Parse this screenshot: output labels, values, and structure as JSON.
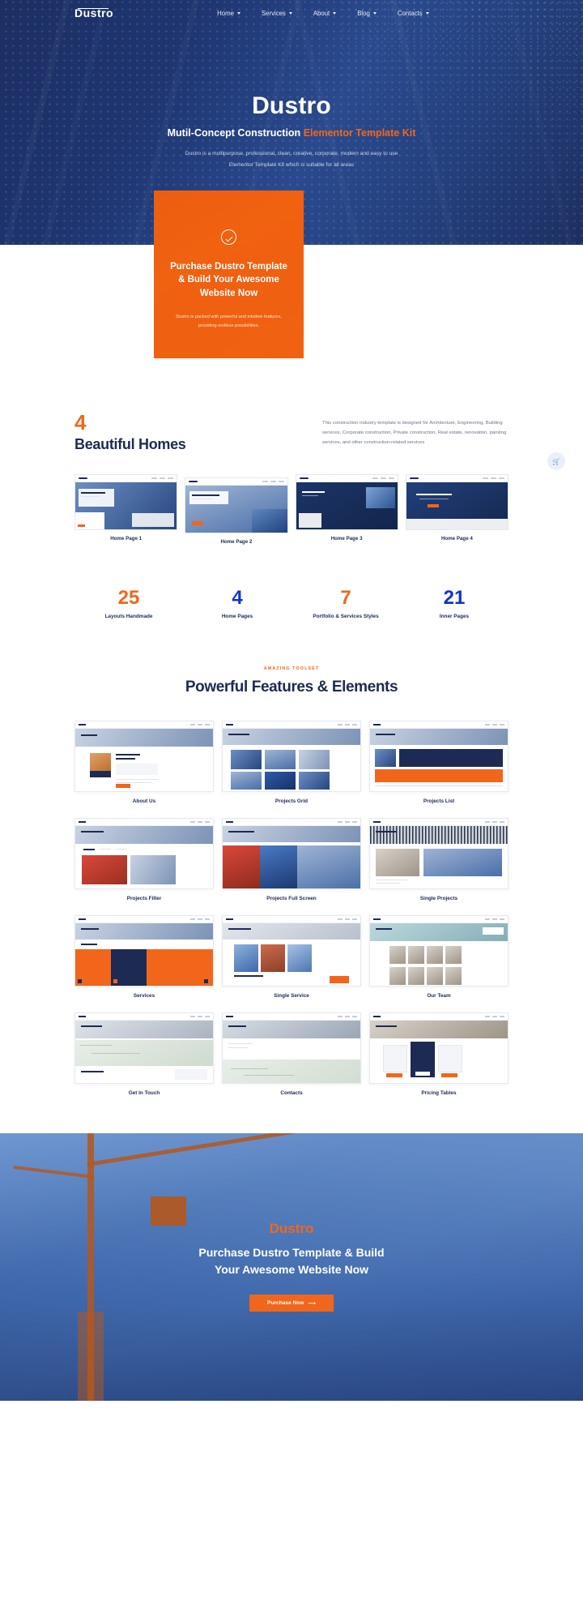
{
  "header": {
    "logo": "Dustro",
    "nav": [
      {
        "label": "Home"
      },
      {
        "label": "Services"
      },
      {
        "label": "About"
      },
      {
        "label": "Blog"
      },
      {
        "label": "Contacts"
      }
    ]
  },
  "hero": {
    "title": "Dustro",
    "subtitle_main": "Mutil-Concept Construction",
    "subtitle_accent": "Elementor Template Kit",
    "desc_line1": "Dustro is a multipurpose, professional, clean, creative, corporate, modern and easy to use",
    "desc_line2": "Elementor Template Kit which is suitable for all areas"
  },
  "promo": {
    "icon": "check-circle-icon",
    "title": "Purchase Dustro Template & Build Your Awesome Website Now",
    "text": "Dustro is packed with powerful and intuitive features, providing endless possibilities."
  },
  "homes": {
    "number": "4",
    "title": "Beautiful Homes",
    "description": "This construction industry template is designed for Architecture, Engineering, Building services, Corporate construction, Private construction, Real estate, renovation, painting services, and other construction-related services",
    "cart_icon": "cart-icon",
    "items": [
      {
        "caption": "Home Page 1"
      },
      {
        "caption": "Home Page 2"
      },
      {
        "caption": "Home Page 3"
      },
      {
        "caption": "Home Page 4"
      }
    ]
  },
  "stats": [
    {
      "number": "25",
      "label": "Layouts Handmade",
      "color": "#f2661b"
    },
    {
      "number": "4",
      "label": "Home Pages",
      "color": "#1433cc"
    },
    {
      "number": "7",
      "label": "Portfolio & Services Styles",
      "color": "#f2661b"
    },
    {
      "number": "21",
      "label": "Inner Pages",
      "color": "#1433cc"
    }
  ],
  "features": {
    "eyebrow": "AMAZING TOOLSET",
    "title": "Powerful Features & Elements",
    "items": [
      {
        "caption": "About Us"
      },
      {
        "caption": "Projects Grid"
      },
      {
        "caption": "Projects List"
      },
      {
        "caption": "Projects Filter"
      },
      {
        "caption": "Projects Full Screen"
      },
      {
        "caption": "Single Projects"
      },
      {
        "caption": "Services"
      },
      {
        "caption": "Single Service"
      },
      {
        "caption": "Our Team"
      },
      {
        "caption": "Get In Touch"
      },
      {
        "caption": "Contacts"
      },
      {
        "caption": "Pricing Tables"
      }
    ]
  },
  "cta": {
    "brand": "Dustro",
    "title_line1": "Purchase Dustro Template & Build",
    "title_line2": "Your Awesome Website Now",
    "button": "Purchase Now",
    "button_icon": "arrow-right-icon"
  },
  "colors": {
    "navy": "#1d2a53",
    "orange": "#f2661b",
    "blue": "#1433cc"
  }
}
